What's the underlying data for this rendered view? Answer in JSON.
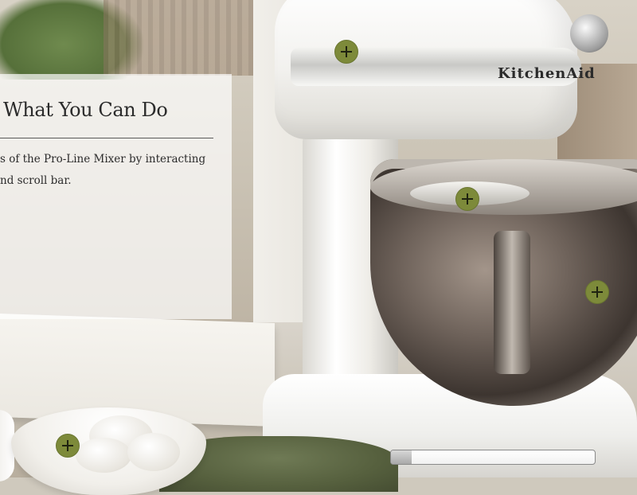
{
  "info_panel": {
    "title": "What You Can Do",
    "body_lines": [
      "s of the Pro-Line Mixer by interacting",
      "nd scroll bar."
    ]
  },
  "mixer_label": "KitchenAid",
  "hotspots": [
    {
      "name": "speed-control",
      "icon": "plus-icon"
    },
    {
      "name": "beater",
      "icon": "plus-icon"
    },
    {
      "name": "bowl",
      "icon": "plus-icon"
    },
    {
      "name": "eggs",
      "icon": "plus-icon"
    }
  ],
  "scrollbar": {
    "position": 0
  },
  "colors": {
    "hotspot": "#7d8a3a",
    "panel_text": "#2b2b2b"
  }
}
